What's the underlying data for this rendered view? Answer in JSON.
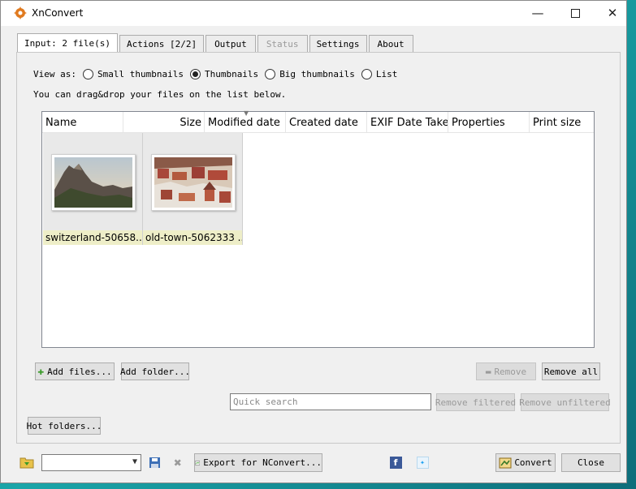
{
  "window": {
    "title": "XnConvert"
  },
  "tabs": [
    {
      "label": "Input: 2 file(s)",
      "state": "active"
    },
    {
      "label": "Actions [2/2]",
      "state": "normal"
    },
    {
      "label": "Output",
      "state": "normal"
    },
    {
      "label": "Status",
      "state": "disabled"
    },
    {
      "label": "Settings",
      "state": "normal"
    },
    {
      "label": "About",
      "state": "normal"
    }
  ],
  "input": {
    "view_as_label": "View as:",
    "view_options": [
      {
        "label": "Small thumbnails",
        "checked": false
      },
      {
        "label": "Thumbnails",
        "checked": true
      },
      {
        "label": "Big thumbnails",
        "checked": false
      },
      {
        "label": "List",
        "checked": false
      }
    ],
    "hint": "You can drag&drop your files on the list below.",
    "columns": [
      "Name",
      "Size",
      "Modified date",
      "Created date",
      "EXIF Date Taken",
      "Properties",
      "Print size"
    ],
    "files": [
      {
        "name": "switzerland-50658...",
        "thumb": "mountain-photo"
      },
      {
        "name": "old-town-5062333 ...",
        "thumb": "old-town-photo"
      }
    ],
    "buttons": {
      "add_files": "Add files...",
      "add_folder": "Add folder...",
      "remove": "Remove",
      "remove_all": "Remove all",
      "remove_filtered": "Remove filtered",
      "remove_unfiltered": "Remove unfiltered",
      "hot_folders": "Hot folders..."
    },
    "search_placeholder": "Quick search"
  },
  "bottom": {
    "export_label": "Export for NConvert...",
    "convert_label": "Convert",
    "close_label": "Close"
  },
  "colors": {
    "accent_orange": "#e07a1f",
    "facebook": "#3b5998",
    "twitter": "#1da1f2"
  }
}
